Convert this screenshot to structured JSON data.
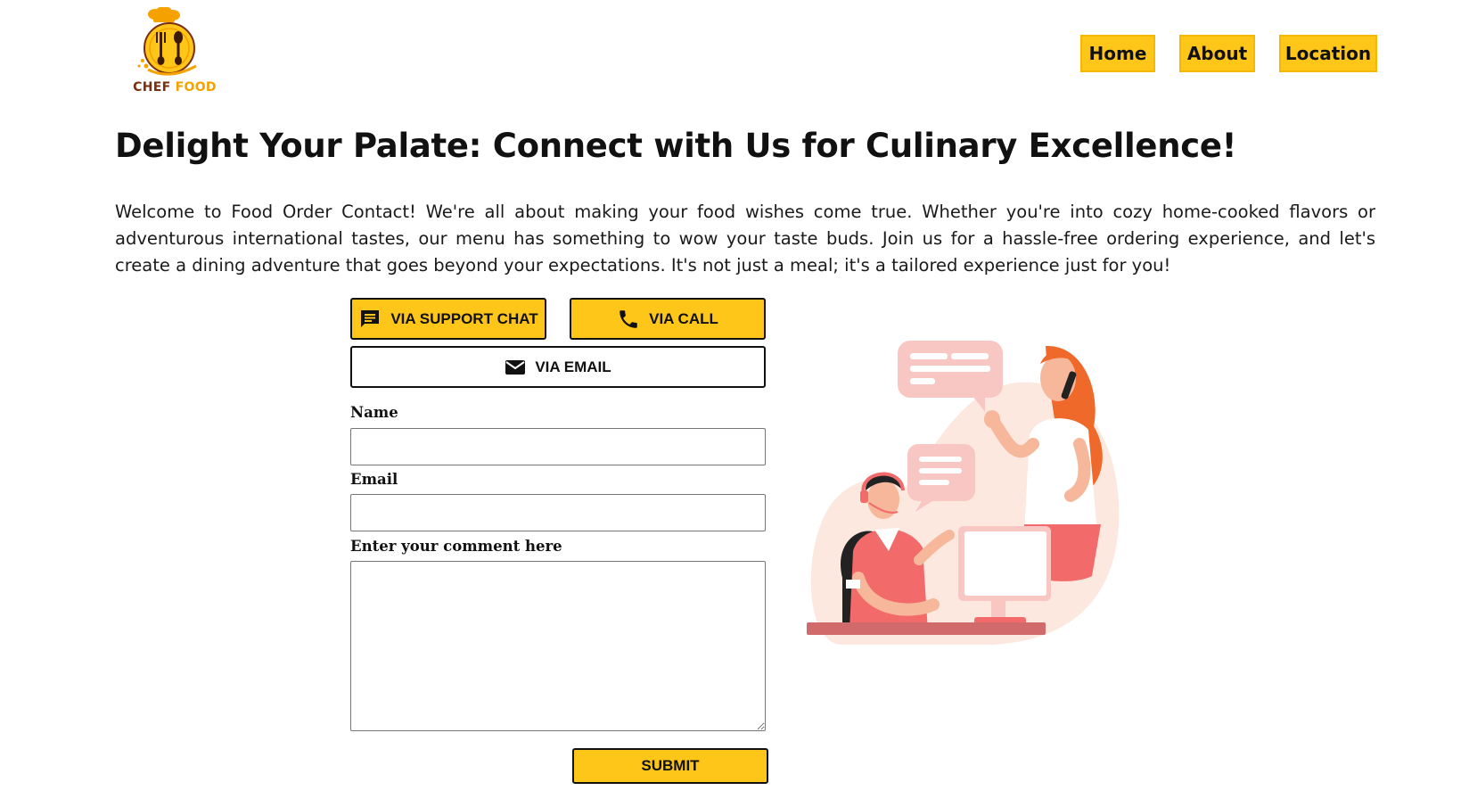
{
  "brand": {
    "logo_word1": "CHEF",
    "logo_word2": "FOOD",
    "primary_color": "#ffc61a",
    "logo_brown": "#7a2e0e",
    "logo_orange": "#f5a200"
  },
  "nav": {
    "items": [
      {
        "label": "Home"
      },
      {
        "label": "About"
      },
      {
        "label": "Location"
      }
    ]
  },
  "hero": {
    "title": "Delight Your Palate: Connect with Us for Culinary Excellence!",
    "intro": "Welcome to Food Order Contact! We're all about making your food wishes come true. Whether you're into cozy home-cooked flavors or adventurous international tastes, our menu has something to wow your taste buds. Join us for a hassle-free ordering experience, and let's create a dining adventure that goes beyond your expectations. It's not just a meal; it's a tailored experience just for you!"
  },
  "contact_options": {
    "support_chat": {
      "label": "VIA SUPPORT CHAT",
      "icon": "chat-icon"
    },
    "call": {
      "label": "VIA CALL",
      "icon": "phone-icon"
    },
    "email": {
      "label": "VIA EMAIL",
      "icon": "envelope-icon"
    }
  },
  "form": {
    "name_label": "Name",
    "name_value": "",
    "email_label": "Email",
    "email_value": "",
    "comment_label": "Enter your comment here",
    "comment_value": "",
    "submit_label": "SUBMIT"
  },
  "illustration": {
    "icon": "customer-support-illustration"
  }
}
